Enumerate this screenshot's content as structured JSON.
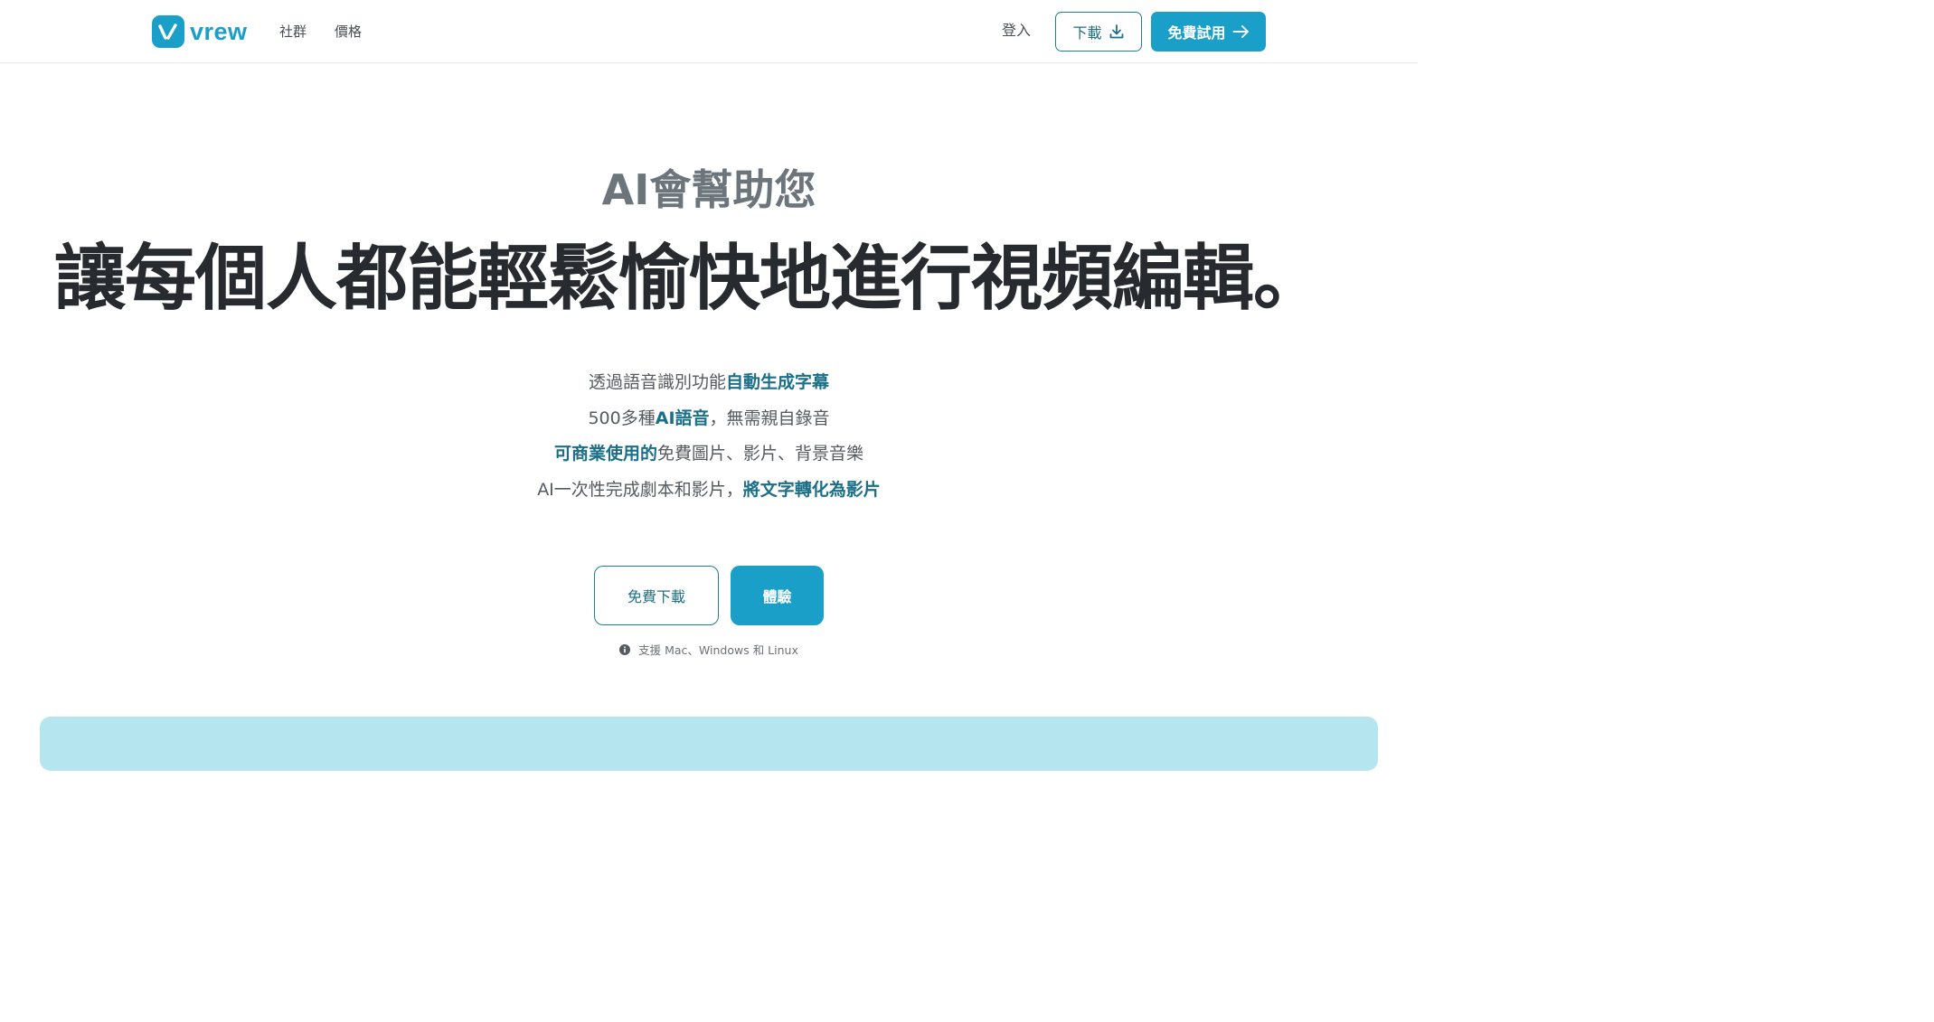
{
  "header": {
    "logo_text": "vrew",
    "nav": [
      "社群",
      "價格"
    ],
    "login_label": "登入",
    "download_label": "下載",
    "trial_label": "免費試用"
  },
  "hero": {
    "eyebrow": "AI會幫助您",
    "headline": "讓每個人都能輕鬆愉快地進行視頻編輯。",
    "features": [
      [
        {
          "text": "透過語音識別功能",
          "hl": false
        },
        {
          "text": "自動生成字幕",
          "hl": true
        }
      ],
      [
        {
          "text": "500多種",
          "hl": false
        },
        {
          "text": "AI語音",
          "hl": true
        },
        {
          "text": "，無需親自錄音",
          "hl": false
        }
      ],
      [
        {
          "text": "可商業使用的",
          "hl": true
        },
        {
          "text": "免費圖片、影片、背景音樂",
          "hl": false
        }
      ],
      [
        {
          "text": "AI一次性完成劇本和影片，",
          "hl": false
        },
        {
          "text": "將文字轉化為影片",
          "hl": true
        }
      ]
    ],
    "cta_download": "免費下載",
    "cta_try": "體驗",
    "support_note": "支援 Mac、Windows 和 Linux"
  },
  "colors": {
    "brand": "#1a9fc9",
    "highlight": "#1b6f88",
    "preview_band": "#b5e6ef"
  },
  "icons": {
    "logo": "vrew-logo-icon",
    "download": "download-icon",
    "arrow": "arrow-right-icon",
    "info": "info-icon"
  }
}
